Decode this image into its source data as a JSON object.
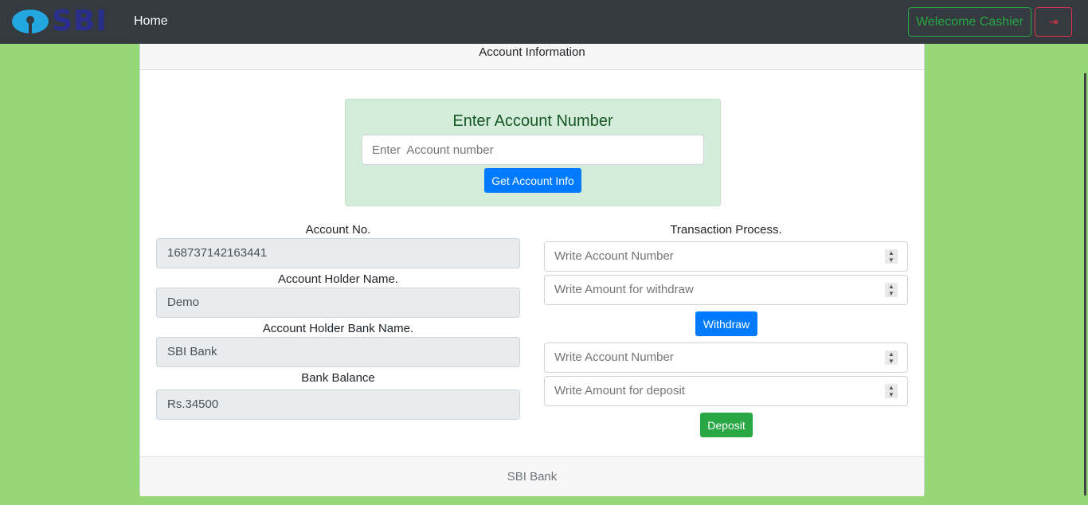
{
  "navbar": {
    "logo_text": "SBI",
    "home_link": "Home",
    "welcome_label": "Welecome Cashier",
    "logout_icon": "sign-out-icon",
    "logout_glyph": "⇥"
  },
  "card": {
    "header_title": "Account Information",
    "footer_text": "SBI Bank"
  },
  "lookup": {
    "title": "Enter Account Number",
    "placeholder": "Enter  Account number",
    "button_label": "Get Account Info"
  },
  "account_info": {
    "account_no_label": "Account No.",
    "account_no_value": "168737142163441",
    "holder_name_label": "Account Holder Name.",
    "holder_name_value": "Demo",
    "bank_name_label": "Account Holder Bank Name.",
    "bank_name_value": "SBI Bank",
    "balance_label": "Bank Balance",
    "balance_value": "Rs.34500"
  },
  "transaction": {
    "title": "Transaction Process.",
    "withdraw_account_placeholder": "Write Account Number",
    "withdraw_amount_placeholder": "Write Amount for withdraw",
    "withdraw_button": "Withdraw",
    "deposit_account_placeholder": "Write Account Number",
    "deposit_amount_placeholder": "Write Amount for deposit",
    "deposit_button": "Deposit"
  },
  "colors": {
    "page_bg": "#96d878",
    "navbar_bg": "#343a40",
    "primary": "#007bff",
    "success": "#28a745",
    "danger": "#dc3545"
  }
}
